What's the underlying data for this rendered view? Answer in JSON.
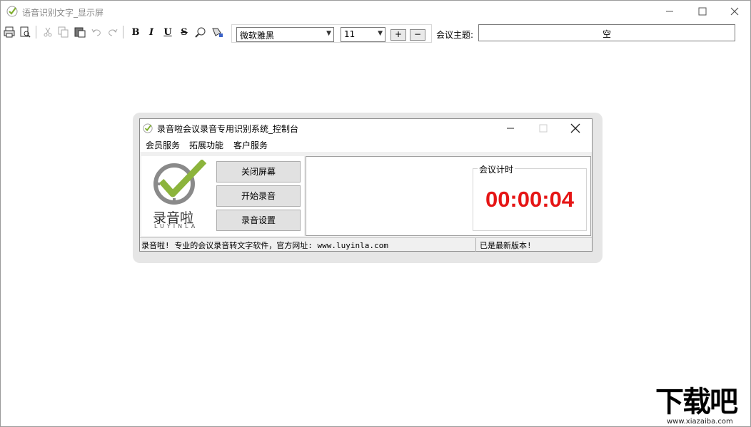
{
  "window": {
    "title": "语音识别文字_显示屏",
    "controls": [
      "minimize",
      "maximize",
      "close"
    ]
  },
  "toolbar": {
    "buttons": [
      {
        "name": "print-icon"
      },
      {
        "name": "print-preview-icon"
      },
      {
        "name": "cut-icon"
      },
      {
        "name": "copy-icon"
      },
      {
        "name": "paste-icon"
      },
      {
        "name": "undo-icon"
      },
      {
        "name": "redo-icon"
      },
      {
        "name": "bold-button",
        "label": "B"
      },
      {
        "name": "italic-button",
        "label": "I"
      },
      {
        "name": "underline-button",
        "label": "U"
      },
      {
        "name": "strikethrough-button",
        "label": "S"
      },
      {
        "name": "find-icon"
      },
      {
        "name": "color-icon"
      }
    ],
    "font_family": "微软雅黑",
    "font_size": "11",
    "increase_label": "+",
    "decrease_label": "−",
    "topic_label": "会议主题:",
    "topic_value": "空"
  },
  "dialog": {
    "title": "录音啦会议录音专用识别系统_控制台",
    "menu": [
      "会员服务",
      "拓展功能",
      "客户服务"
    ],
    "logo_text": "录音啦",
    "logo_subtext": "LUYINLA",
    "buttons": [
      "关闭屏幕",
      "开始录音",
      "录音设置"
    ],
    "timer_label": "会议计时",
    "timer_value": "00:00:04",
    "status_left": "录音啦! 专业的会议录音转文字软件，官方网址: www.luyinla.com",
    "status_right": "已是最新版本!"
  },
  "watermark": {
    "big": "下载吧",
    "small": "www.xiazaiba.com"
  },
  "colors": {
    "timer": "#e51515",
    "logo_green": "#8cb43c",
    "logo_gray": "#8a8a8a"
  }
}
